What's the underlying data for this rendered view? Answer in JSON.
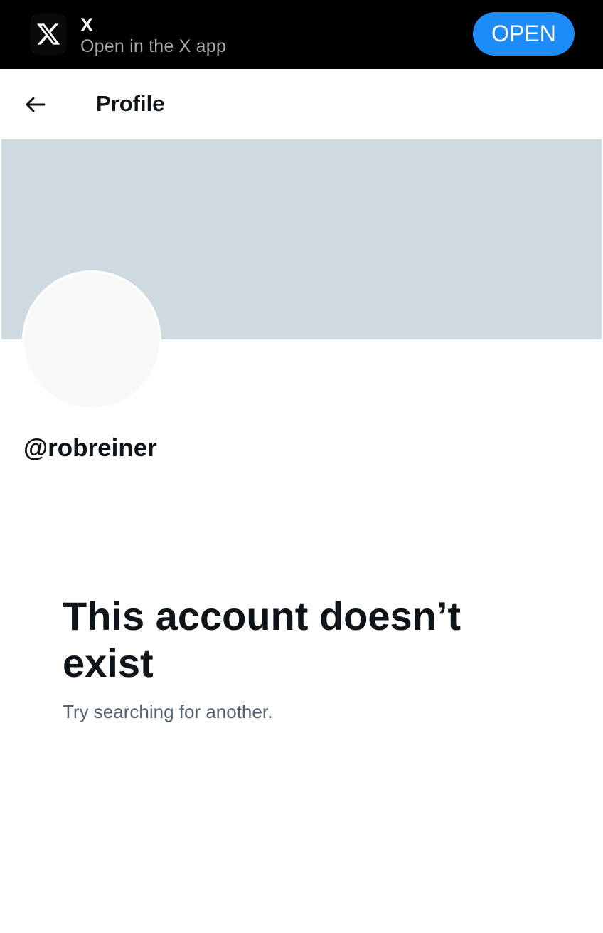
{
  "banner": {
    "app_icon": "x-logo-icon",
    "app_name": "X",
    "subtitle": "Open in the X app",
    "open_label": "OPEN",
    "open_color": "#1d8cf8"
  },
  "header": {
    "back_icon": "arrow-left-icon",
    "title": "Profile"
  },
  "profile": {
    "cover_color": "#cfd9e0",
    "handle": "@robreiner"
  },
  "empty_state": {
    "title": "This account doesn’t exist",
    "subtitle": "Try searching for another."
  }
}
